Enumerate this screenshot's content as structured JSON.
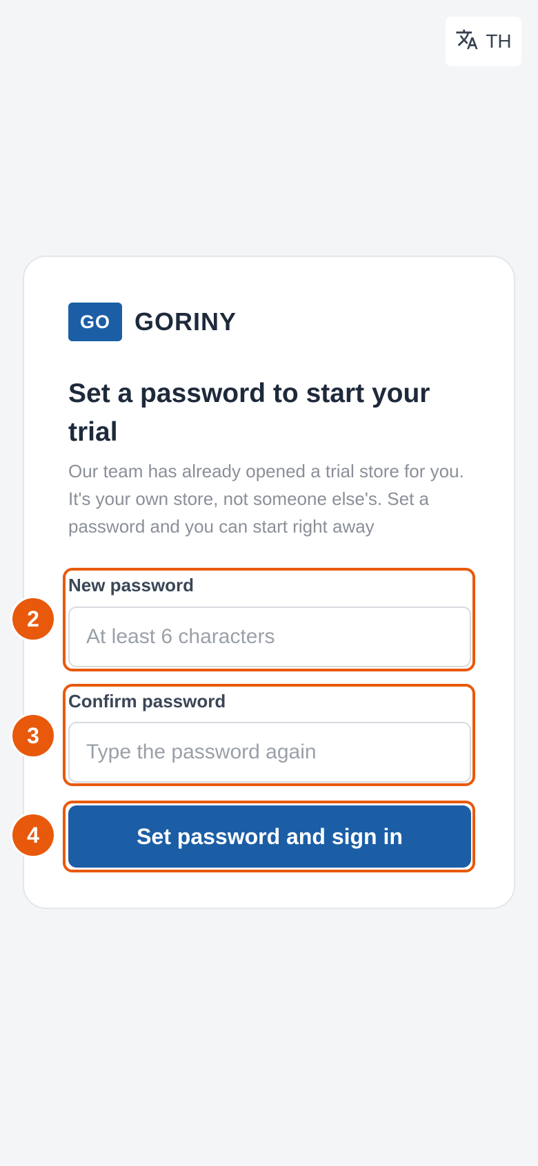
{
  "language": {
    "icon": "translate-icon",
    "code": "TH"
  },
  "brand": {
    "badge": "GO",
    "name": "GORINY",
    "color": "#1b5ea6"
  },
  "heading": "Set a password to start your trial",
  "subtext": "Our team has already opened a trial store for you. It's your own store, not someone else's. Set a password and you can start right away",
  "new_password": {
    "label": "New password",
    "placeholder": "At least 6 characters",
    "value": ""
  },
  "confirm_password": {
    "label": "Confirm password",
    "placeholder": "Type the password again",
    "value": ""
  },
  "submit": {
    "label": "Set password and sign in"
  },
  "steps": [
    "2",
    "3",
    "4"
  ],
  "colors": {
    "accent": "#1b5ea6",
    "highlight": "#e8590c",
    "background": "#f4f5f7"
  }
}
